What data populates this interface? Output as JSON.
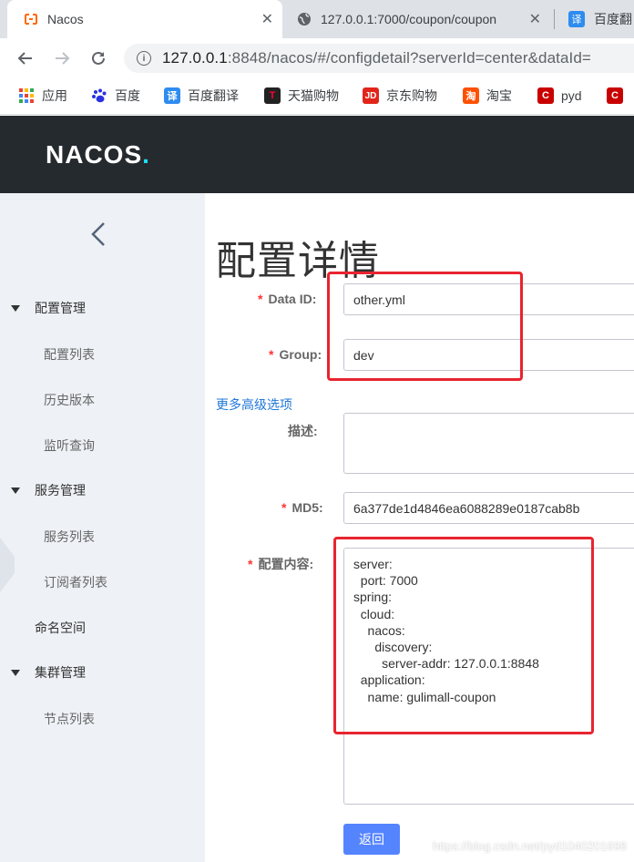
{
  "browser": {
    "tabs": [
      {
        "title": "Nacos",
        "icon": "nacos-favicon",
        "active": true
      },
      {
        "title": "127.0.0.1:7000/coupon/coupon",
        "icon": "globe-icon",
        "active": false
      },
      {
        "title": "百度翻",
        "icon": "baidu-translate-favicon",
        "active": false
      }
    ],
    "url": {
      "host": "127.0.0.1",
      "rest": ":8848/nacos/#/configdetail?serverId=center&dataId="
    },
    "bookmarks": [
      {
        "label": "应用",
        "icon": "apps-grid-icon",
        "color": "#4285f4"
      },
      {
        "label": "百度",
        "icon": "baidu-paw-icon",
        "color": "#2932e1"
      },
      {
        "label": "百度翻译",
        "icon": "baidu-translate-icon",
        "color": "#2e8cf0",
        "glyph": "译"
      },
      {
        "label": "天猫购物",
        "icon": "tmall-icon",
        "color": "#222222",
        "glyph": "T"
      },
      {
        "label": "京东购物",
        "icon": "jd-icon",
        "color": "#e1251b",
        "glyph": "JD"
      },
      {
        "label": "淘宝",
        "icon": "taobao-icon",
        "color": "#ff5000",
        "glyph": "淘"
      },
      {
        "label": "pyd",
        "icon": "csdn-icon",
        "color": "#c90000",
        "glyph": "C"
      },
      {
        "label": "",
        "icon": "csdn-icon",
        "color": "#c90000",
        "glyph": "C"
      }
    ]
  },
  "app": {
    "logo": {
      "text": "NACOS",
      "dot": "."
    },
    "sidebar": {
      "groups": [
        {
          "label": "配置管理",
          "items": [
            "配置列表",
            "历史版本",
            "监听查询"
          ]
        },
        {
          "label": "服务管理",
          "items": [
            "服务列表",
            "订阅者列表"
          ]
        },
        {
          "label": "命名空间",
          "items": []
        },
        {
          "label": "集群管理",
          "items": [
            "节点列表"
          ]
        }
      ]
    },
    "page_title": "配置详情",
    "form": {
      "data_id": {
        "label": "Data ID:",
        "value": "other.yml"
      },
      "group": {
        "label": "Group:",
        "value": "dev"
      },
      "advanced_link": "更多高级选项",
      "description": {
        "label": "描述:",
        "value": ""
      },
      "md5": {
        "label": "MD5:",
        "value": "6a377de1d4846ea6088289e0187cab8b"
      },
      "content": {
        "label": "配置内容:",
        "value": "server:\n  port: 7000\nspring:\n  cloud:\n    nacos:\n      discovery:\n        server-addr: 127.0.0.1:8848\n  application:\n    name: gulimall-coupon"
      },
      "back_button": "返回"
    },
    "watermark": "https://blog.csdn.net/pyd1040201698"
  },
  "colors": {
    "header_bg": "#252a2f",
    "sidebar_bg": "#eef1f6",
    "primary": "#5584ff",
    "link": "#2077d9",
    "annotation": "#e8242f"
  }
}
